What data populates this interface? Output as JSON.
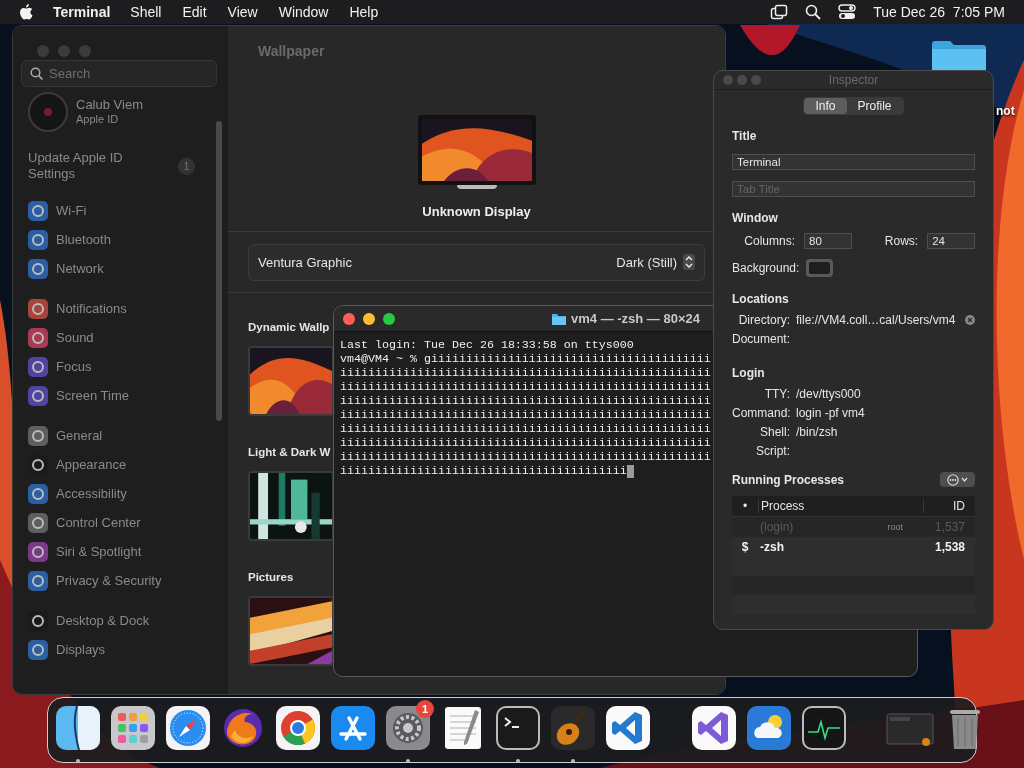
{
  "menu_bar": {
    "app": "Terminal",
    "menus": [
      "Shell",
      "Edit",
      "View",
      "Window",
      "Help"
    ],
    "clock": "Tue Dec 26  7:05 PM"
  },
  "desktop": {
    "labels": [
      "not"
    ]
  },
  "settings_window": {
    "search": {
      "placeholder": "Search"
    },
    "account": {
      "name": "Calub Viem",
      "subtitle": "Apple ID"
    },
    "update": {
      "label": "Update Apple ID Settings",
      "badge": "1"
    },
    "sidebar_groups": [
      {
        "items": [
          {
            "label": "Wi-Fi",
            "color": "#2b5fa3"
          },
          {
            "label": "Bluetooth",
            "color": "#2b5fa3"
          },
          {
            "label": "Network",
            "color": "#2b5fa3"
          }
        ]
      },
      {
        "items": [
          {
            "label": "Notifications",
            "color": "#a8443c"
          },
          {
            "label": "Sound",
            "color": "#a83a52"
          },
          {
            "label": "Focus",
            "color": "#4f44a0"
          },
          {
            "label": "Screen Time",
            "color": "#4f44a0"
          }
        ]
      },
      {
        "items": [
          {
            "label": "General",
            "color": "#5e5e5e"
          },
          {
            "label": "Appearance",
            "color": "#1a1a1a"
          },
          {
            "label": "Accessibility",
            "color": "#2b5fa3"
          },
          {
            "label": "Control Center",
            "color": "#5e5e5e"
          },
          {
            "label": "Siri & Spotlight",
            "color": "#7a3a8a"
          },
          {
            "label": "Privacy & Security",
            "color": "#2b5fa3"
          }
        ]
      },
      {
        "items": [
          {
            "label": "Desktop & Dock",
            "color": "#1a1a1a"
          },
          {
            "label": "Displays",
            "color": "#2b5fa3"
          }
        ]
      }
    ],
    "page_title": "Wallpaper",
    "display_name": "Unknown Display",
    "wallpaper": {
      "name": "Ventura Graphic",
      "style": "Dark (Still)"
    },
    "sections": [
      {
        "heading": "Dynamic Wallp"
      },
      {
        "heading": "Light & Dark W"
      },
      {
        "heading": "Pictures"
      }
    ]
  },
  "terminal": {
    "title": "vm4 — -zsh — 80×24",
    "cursor": true,
    "lines": [
      "Last login: Tue Dec 26 18:33:58 on ttys000",
      "vm4@VM4 ~ % giiiiiiiiiiiiiiiiiiiiiiiiiiiiiiiiiiiiiiii",
      "iiiiiiiiiiiiiiiiiiiiiiiiiiiiiiiiiiiiiiiiiiiiiiiiiiiii",
      "iiiiiiiiiiiiiiiiiiiiiiiiiiiiiiiiiiiiiiiiiiiiiiiiiiiii",
      "iiiiiiiiiiiiiiiiiiiiiiiiiiiiiiiiiiiiiiiiiiiiiiiiiiiii",
      "iiiiiiiiiiiiiiiiiiiiiiiiiiiiiiiiiiiiiiiiiiiiiiiiiiiii",
      "iiiiiiiiiiiiiiiiiiiiiiiiiiiiiiiiiiiiiiiiiiiiiiiiiiiii",
      "iiiiiiiiiiiiiiiiiiiiiiiiiiiiiiiiiiiiiiiiiiiiiiiiiiiii",
      "iiiiiiiiiiiiiiiiiiiiiiiiiiiiiiiiiiiiiiiiiiiiiiiiiiiii",
      "iiiiiiiiiiiiiiiiiiiiiiiiiiiiiiiiiiiiiiiii"
    ]
  },
  "inspector": {
    "title": "Inspector",
    "tabs": [
      {
        "label": "Info",
        "selected": true
      },
      {
        "label": "Profile",
        "selected": false
      }
    ],
    "title_section": {
      "heading": "Title",
      "value": "Terminal",
      "tab_title_placeholder": "Tab Title"
    },
    "window_section": {
      "heading": "Window",
      "columns_label": "Columns:",
      "columns": "80",
      "rows_label": "Rows:",
      "rows": "24",
      "background_label": "Background:"
    },
    "locations": {
      "heading": "Locations",
      "fields": [
        {
          "label": "Directory:",
          "value": "file://VM4.coll…cal/Users/vm4"
        },
        {
          "label": "Document:"
        }
      ]
    },
    "login": {
      "heading": "Login",
      "fields": [
        {
          "label": "TTY:",
          "value": "/dev/ttys000"
        },
        {
          "label": "Command:",
          "value": "login -pf vm4"
        },
        {
          "label": "Shell:",
          "value": "/bin/zsh"
        },
        {
          "label": "Script:"
        }
      ]
    },
    "processes": {
      "heading": "Running Processes",
      "columns": [
        "•",
        "Process",
        "ID"
      ],
      "rows": [
        {
          "name": "(login)",
          "user": "root",
          "id": "1,537",
          "current": false
        },
        {
          "marker": "$",
          "name": "-zsh",
          "id": "1,538",
          "current": true
        }
      ]
    }
  },
  "dock": {
    "items": [
      {
        "kind": "finder",
        "running": true
      },
      {
        "kind": "grid",
        "running": false
      },
      {
        "kind": "compass",
        "running": false
      },
      {
        "kind": "swirl",
        "running": false
      },
      {
        "kind": "tricolor",
        "running": false
      },
      {
        "kind": "store",
        "running": false
      },
      {
        "kind": "gear",
        "running": true,
        "badge": "1"
      },
      {
        "kind": "notepad",
        "running": false
      },
      {
        "kind": "prompt",
        "running": true
      },
      {
        "kind": "guitar",
        "running": true
      },
      {
        "kind": "ribbon",
        "color": "#1f7ad0",
        "running": false
      },
      {
        "kind": "separator"
      },
      {
        "kind": "ribbon",
        "color": "#7d5bd6",
        "running": false
      },
      {
        "kind": "weather",
        "running": false
      },
      {
        "kind": "monitor",
        "running": false
      },
      {
        "kind": "separator"
      },
      {
        "kind": "thumbnail",
        "running": false
      },
      {
        "kind": "trash",
        "running": false
      }
    ]
  }
}
